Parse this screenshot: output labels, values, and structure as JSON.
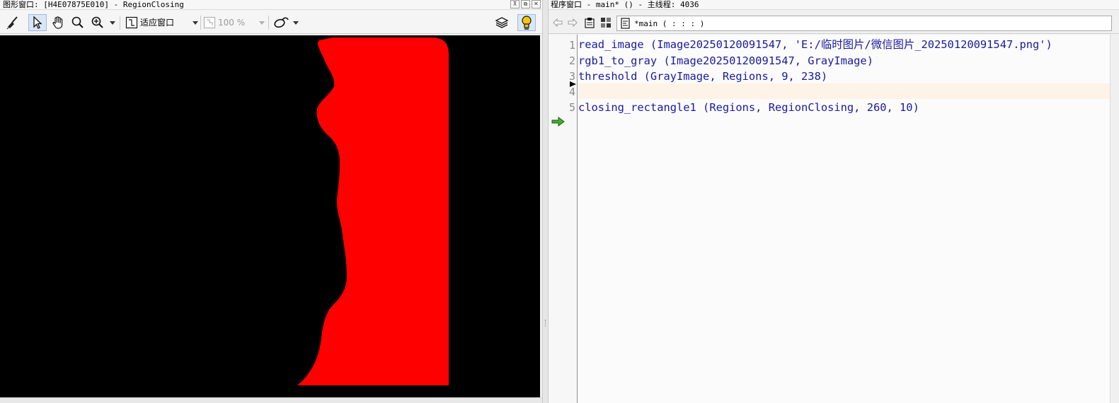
{
  "graphics_window": {
    "title": "图形窗口: [H4E07875E010] - RegionClosing",
    "window_buttons": [
      "pin",
      "float",
      "close"
    ],
    "toolbar": {
      "tools": [
        "broom-icon",
        "pointer-icon",
        "hand-icon",
        "magnifier-icon",
        "zoom-in-icon",
        "fit-window-icon",
        "zoom-percent-icon",
        "draw-shape-icon",
        "layers-icon",
        "lightbulb-icon"
      ],
      "fit_label": "适应窗口",
      "zoom_value": "100 %"
    },
    "canvas": {
      "background": "#000000",
      "region_color": "#ff0000",
      "region_name": "RegionClosing"
    }
  },
  "program_window": {
    "title": "程序窗口 - main* () - 主线程: 4036",
    "toolbar": {
      "tools": [
        "back-arrow-icon",
        "forward-arrow-icon",
        "clipboard-icon",
        "grid-icon"
      ],
      "procedure": "*main ( : : : )"
    },
    "lines": [
      {
        "number": "1",
        "code": "read_image (Image20250120091547, 'E:/临时图片/微信图片_20250120091547.png')"
      },
      {
        "number": "2",
        "code": "rgb1_to_gray (Image20250120091547, GrayImage)"
      },
      {
        "number": "3",
        "code": "threshold (GrayImage, Regions, 9, 238)"
      },
      {
        "number": "4",
        "code": ""
      },
      {
        "number": "5",
        "code": "closing_rectangle1 (Regions, RegionClosing, 260, 10)"
      }
    ],
    "code_color": "#1a1a9e",
    "current_line_highlight": "#fdf3e6"
  }
}
